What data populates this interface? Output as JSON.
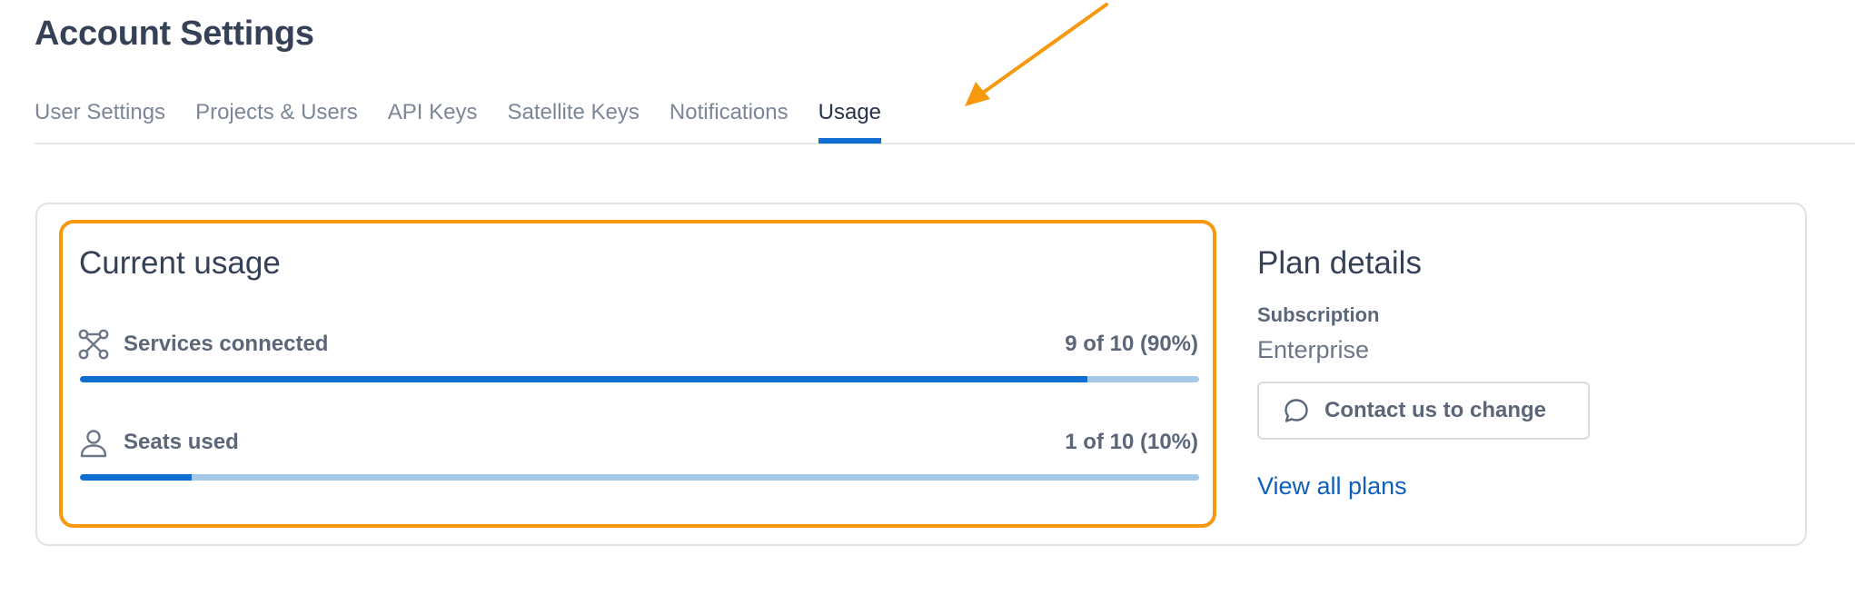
{
  "page": {
    "title": "Account Settings"
  },
  "tabs": [
    {
      "label": "User Settings",
      "active": false
    },
    {
      "label": "Projects & Users",
      "active": false
    },
    {
      "label": "API Keys",
      "active": false
    },
    {
      "label": "Satellite Keys",
      "active": false
    },
    {
      "label": "Notifications",
      "active": false
    },
    {
      "label": "Usage",
      "active": true
    }
  ],
  "usage": {
    "title": "Current usage",
    "metrics": [
      {
        "icon": "services-connected-icon",
        "label": "Services connected",
        "value_text": "9 of 10 (90%)",
        "used": 9,
        "total": 10,
        "percent": 90
      },
      {
        "icon": "user-icon",
        "label": "Seats used",
        "value_text": "1 of 10 (10%)",
        "used": 1,
        "total": 10,
        "percent": 10
      }
    ]
  },
  "plan": {
    "title": "Plan details",
    "subscription_label": "Subscription",
    "subscription_value": "Enterprise",
    "contact_button_label": "Contact us to change",
    "contact_button_icon": "chat-bubble-icon",
    "view_plans_link": "View all plans"
  },
  "colors": {
    "accent": "#0f6fd0",
    "bar_track": "#a5c8e8",
    "highlight": "#f6990f",
    "link": "#0f5fbd"
  }
}
